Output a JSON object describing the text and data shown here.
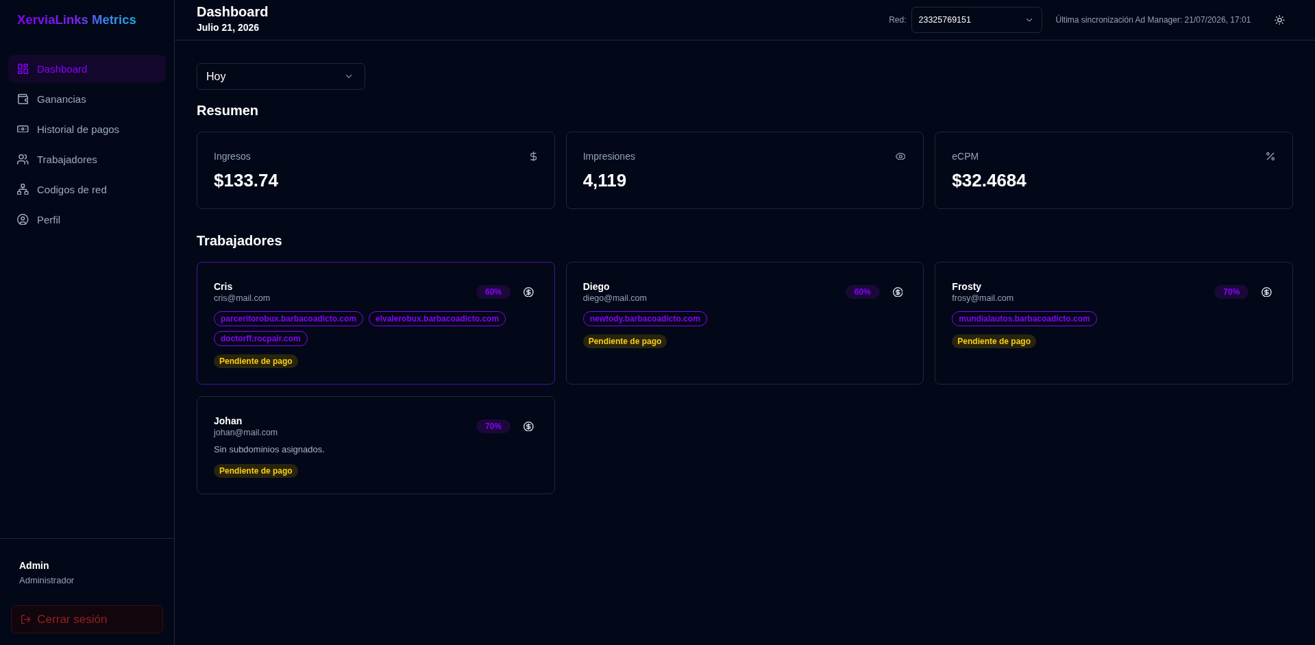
{
  "sidebar": {
    "logo": "XerviaLinks Metrics",
    "items": [
      {
        "kind": "dashboard",
        "label": "Dashboard",
        "selected": true
      },
      {
        "kind": "earnings",
        "label": "Ganancias",
        "selected": false
      },
      {
        "kind": "payments",
        "label": "Historial de pagos",
        "selected": false
      },
      {
        "kind": "workers",
        "label": "Trabajadores",
        "selected": false
      },
      {
        "kind": "codes",
        "label": "Codigos de red",
        "selected": false
      },
      {
        "kind": "profile",
        "label": "Perfil",
        "selected": false
      }
    ],
    "user": {
      "name": "Admin",
      "role": "Administrador"
    },
    "logout_button": "Cerrar sesión"
  },
  "header": {
    "title": "Dashboard",
    "date": "Julio 21, 2026",
    "network_label": "Red:",
    "network_select": {
      "value": "23325769151"
    },
    "sync_status": "Última sincronización Ad Manager: 21/07/2026, 17:01"
  },
  "period_select": {
    "value": "Hoy"
  },
  "summary": {
    "title": "Resumen",
    "cards": [
      {
        "kind": "revenue",
        "label": "Ingresos",
        "value": "$133.74"
      },
      {
        "kind": "impressions",
        "label": "Impresiones",
        "value": "4,119"
      },
      {
        "kind": "ecpm",
        "label": "eCPM",
        "value": "$32.4684"
      }
    ]
  },
  "workers": {
    "title": "Trabajadores",
    "cards": [
      {
        "name": "Cris",
        "email": "cris@mail.com",
        "share": "60%",
        "highlighted": true,
        "domains": [
          "parceritorobux.barbacoadicto.com",
          "elvalerobux.barbacoadicto.com",
          "doctorff.rocpair.com"
        ],
        "status": "Pendiente de pago"
      },
      {
        "name": "Diego",
        "email": "diego@mail.com",
        "share": "60%",
        "highlighted": false,
        "domains": [
          "newtody.barbacoadicto.com"
        ],
        "status": "Pendiente de pago"
      },
      {
        "name": "Frosty",
        "email": "frosy@mail.com",
        "share": "70%",
        "highlighted": false,
        "domains": [
          "mundialautos.barbacoadicto.com"
        ],
        "status": "Pendiente de pago"
      },
      {
        "name": "Johan",
        "email": "johan@mail.com",
        "share": "70%",
        "highlighted": false,
        "note": "Sin subdominios asignados.",
        "status": "Pendiente de pago"
      }
    ]
  }
}
